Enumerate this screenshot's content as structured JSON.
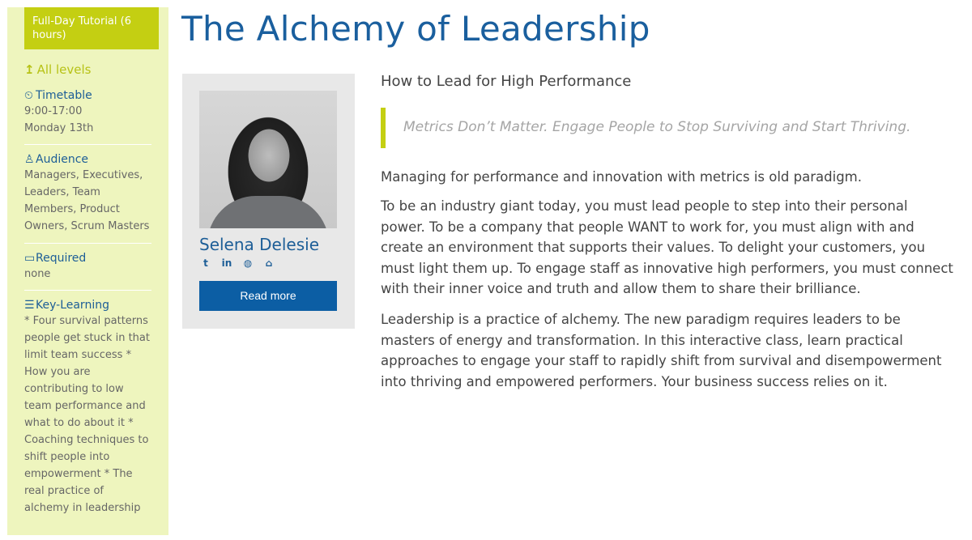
{
  "sidebar": {
    "badge": "Full-Day Tutorial (6 hours)",
    "level": "All levels",
    "timetable": {
      "title": "Timetable",
      "time": "9:00-17:00",
      "day": "Monday 13th"
    },
    "audience": {
      "title": "Audience",
      "text": "Managers, Executives, Leaders, Team Members, Product Owners, Scrum Masters"
    },
    "required": {
      "title": "Required",
      "text": "none"
    },
    "key_learning": {
      "title": "Key-Learning",
      "text": "* Four survival patterns people get stuck in that limit team success * How you are contributing to low team performance and what to do about it * Coaching techniques to shift people into empowerment * The real practice of alchemy in leadership"
    }
  },
  "title": "The Alchemy of Leadership",
  "speaker": {
    "name": "Selena Delesie",
    "social_icons": [
      "twitter-icon",
      "linkedin-icon",
      "globe-icon",
      "home-icon"
    ],
    "read_more": "Read more"
  },
  "main": {
    "subtitle": "How to Lead for High Performance",
    "quote": "Metrics Don’t Matter. Engage People to Stop Surviving and Start Thriving.",
    "p1": "Managing for performance and innovation with metrics is old paradigm.",
    "p2": "To be an industry giant today, you must lead people to step into their personal power. To be a company that people WANT to work for, you must align with and create an environment that supports their values. To delight your customers, you must light them up. To engage staff as innovative high performers, you must connect with their inner voice and truth and allow them to share their brilliance.",
    "p3": "Leadership is a practice of alchemy. The new paradigm requires leaders to be masters of energy and transformation. In this interactive class, learn practical approaches to engage your staff to rapidly shift from survival and disempowerment into thriving and empowered performers. Your business success relies on it."
  },
  "colors": {
    "accent": "#c4cf12",
    "sidebar_bg": "#eef5be",
    "brand_blue": "#1a5f9e",
    "button": "#0c5ea4"
  }
}
